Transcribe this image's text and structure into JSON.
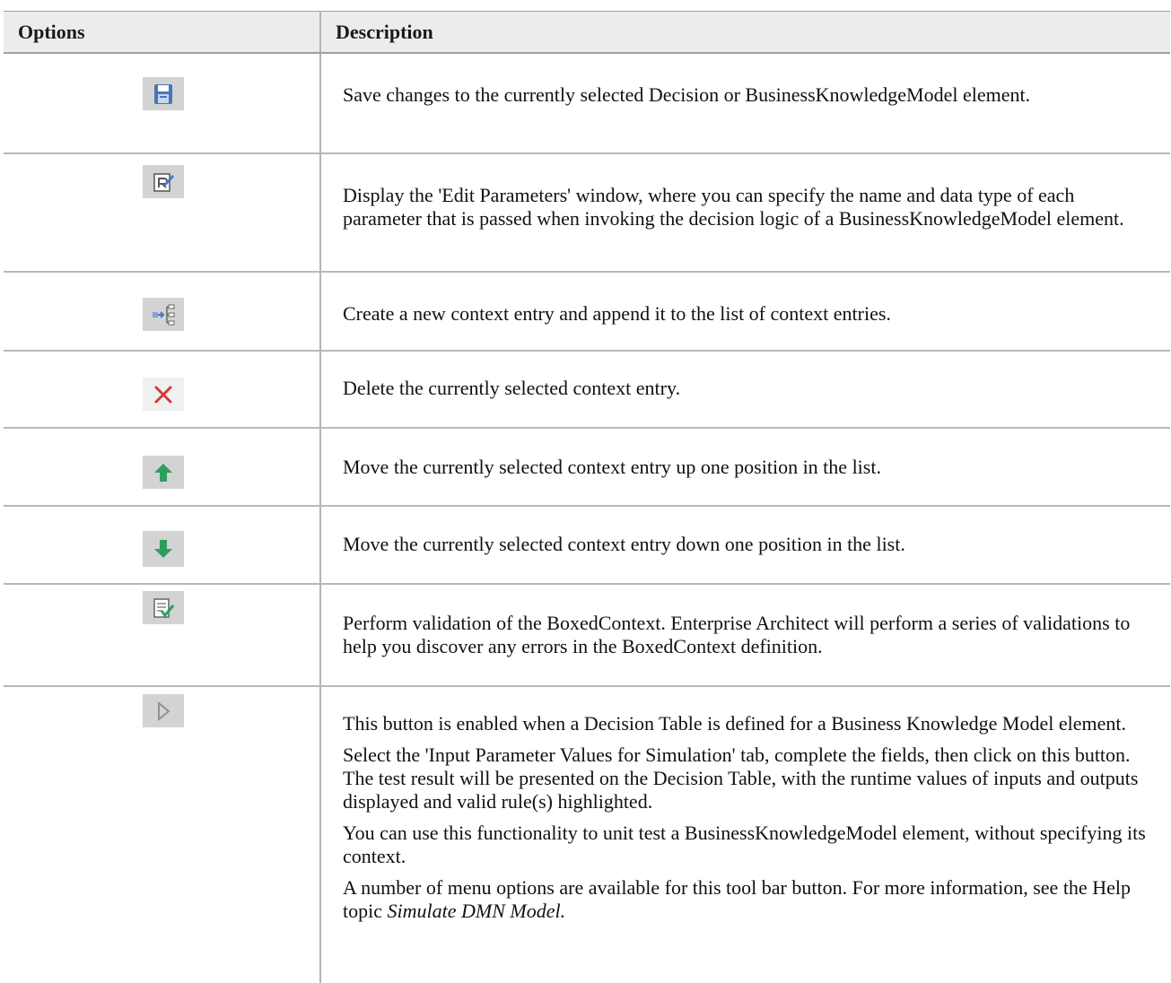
{
  "headers": {
    "options": "Options",
    "description": "Description"
  },
  "rows": [
    {
      "icon": "save-icon",
      "description": "Save changes to the currently selected Decision or BusinessKnowledgeModel element."
    },
    {
      "icon": "edit-parameters-icon",
      "description": "Display the 'Edit Parameters' window, where you can specify the name and data type of each parameter that is passed when invoking the decision logic of a BusinessKnowledgeModel element."
    },
    {
      "icon": "new-context-entry-icon",
      "description": "Create a new context entry and append it to the list of context entries."
    },
    {
      "icon": "delete-icon",
      "description": "Delete the currently selected context entry."
    },
    {
      "icon": "move-up-icon",
      "description": "Move the currently selected context entry up one position in the list."
    },
    {
      "icon": "move-down-icon",
      "description": "Move the currently selected context entry down one position in the list."
    },
    {
      "icon": "validate-icon",
      "description": "Perform validation of the BoxedContext.  Enterprise Architect will perform a series of validations to help you discover any errors in the BoxedContext definition."
    },
    {
      "icon": "run-simulation-icon",
      "paragraphs": [
        "This button is enabled when a Decision Table is defined for a Business Knowledge Model element.",
        "Select the 'Input Parameter Values for Simulation' tab, complete the fields, then click on this button. The test result will be presented on the Decision Table, with the runtime values of inputs and outputs displayed and valid rule(s) highlighted.",
        "You can use this functionality to unit test a BusinessKnowledgeModel element, without specifying its context."
      ],
      "last_paragraph_prefix": "A number of menu options are available for this tool bar button. For more information, see the Help topic ",
      "last_paragraph_link": "Simulate DMN Model."
    }
  ],
  "colors": {
    "header_bg": "#ececec",
    "icon_bg": "#d3d3d3",
    "grid_line": "#b8b8b8",
    "arrow_green": "#2e9e5e",
    "delete_red": "#d23a3a",
    "save_blue": "#4a74b8"
  }
}
